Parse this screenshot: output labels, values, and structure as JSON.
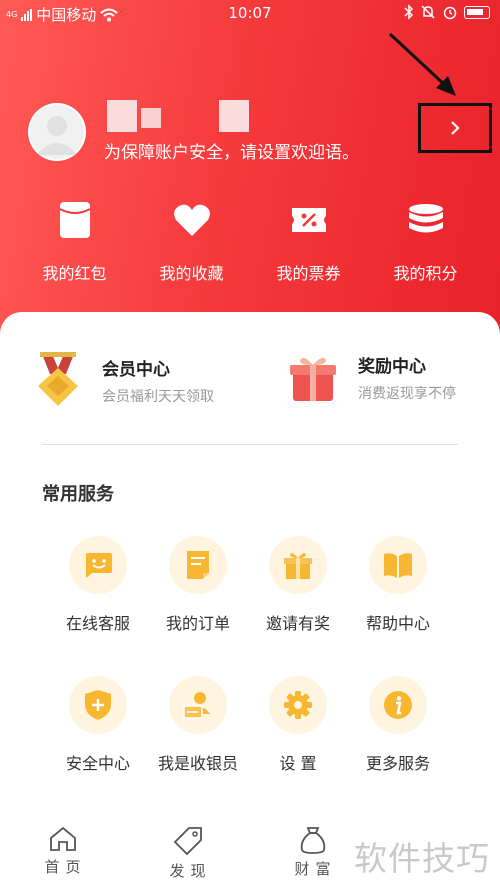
{
  "status_bar": {
    "network_label": "4G",
    "carrier": "中国移动",
    "time": "10:07"
  },
  "profile": {
    "welcome_prompt": "为保障账户安全，请设置欢迎语。"
  },
  "quick_actions": [
    {
      "label": "我的红包",
      "icon": "red-packet-icon"
    },
    {
      "label": "我的收藏",
      "icon": "heart-icon"
    },
    {
      "label": "我的票券",
      "icon": "coupon-icon"
    },
    {
      "label": "我的积分",
      "icon": "points-coins-icon"
    }
  ],
  "promo": {
    "member": {
      "title": "会员中心",
      "subtitle": "会员福利天天领取",
      "icon": "medal-icon"
    },
    "reward": {
      "title": "奖励中心",
      "subtitle": "消费返现享不停",
      "icon": "gift-box-icon"
    }
  },
  "services": {
    "title": "常用服务",
    "items": [
      {
        "label": "在线客服",
        "icon": "chat-smile-icon"
      },
      {
        "label": "我的订单",
        "icon": "order-document-icon"
      },
      {
        "label": "邀请有奖",
        "icon": "gift-icon"
      },
      {
        "label": "帮助中心",
        "icon": "book-icon"
      },
      {
        "label": "安全中心",
        "icon": "shield-plus-icon"
      },
      {
        "label": "我是收银员",
        "icon": "cashier-icon"
      },
      {
        "label": "设 置",
        "icon": "gear-icon"
      },
      {
        "label": "更多服务",
        "icon": "info-icon"
      }
    ]
  },
  "bottom_nav": [
    {
      "label": "首页",
      "icon": "home-icon"
    },
    {
      "label": "发现",
      "icon": "tag-icon"
    },
    {
      "label": "财富",
      "icon": "money-bag-icon"
    }
  ],
  "watermark": "软件技巧",
  "colors": {
    "header_red": "#f23a3c",
    "service_icon_bg": "#fef4e0",
    "service_icon_fg": "#f8b730"
  }
}
